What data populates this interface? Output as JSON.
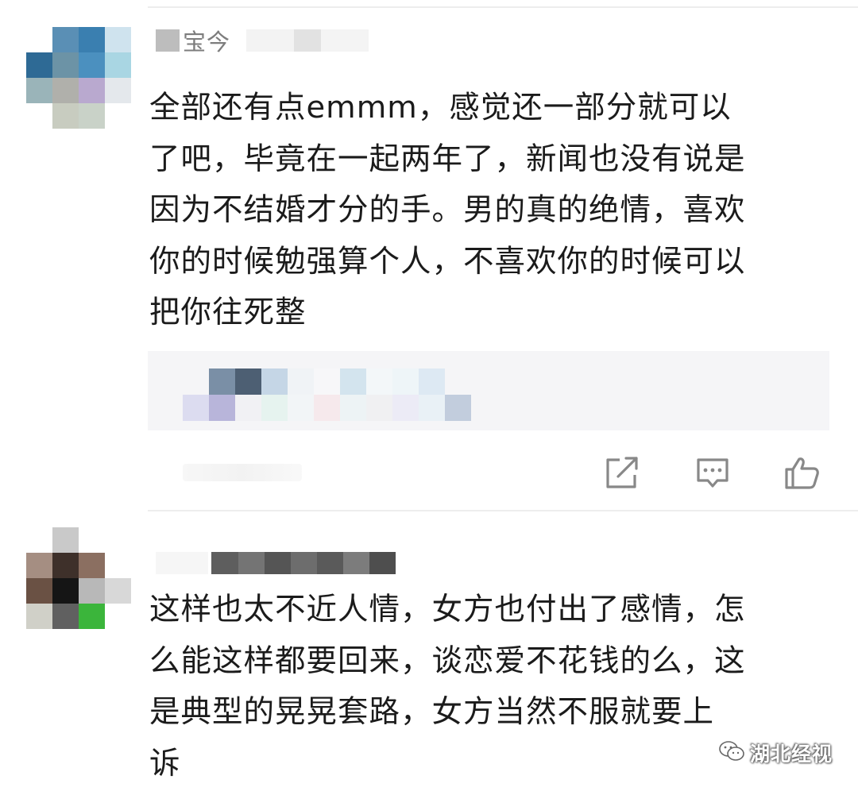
{
  "comments": [
    {
      "username_visible": "宝今",
      "lines": [
        "全部还有点emmm，感觉还一部分就可以",
        "了吧，毕竟在一起两年了，新闻也没有说是",
        "因为不结婚才分的手。男的真的绝情，喜欢",
        "你的时候勉强算个人，不喜欢你的时候可以",
        "把你往死整"
      ]
    },
    {
      "username_visible": "",
      "lines": [
        "这样也太不近人情，女方也付出了感情，怎",
        "么能这样都要回来，谈恋爱不花钱的么，这",
        "是典型的晃晃套路，女方当然不服就要上",
        "诉"
      ]
    }
  ],
  "icons": {
    "share": "edit-icon",
    "reply": "comment-icon",
    "like": "thumbs-up-icon"
  },
  "watermark": {
    "text": "湖北经视",
    "icon": "wechat-icon"
  }
}
